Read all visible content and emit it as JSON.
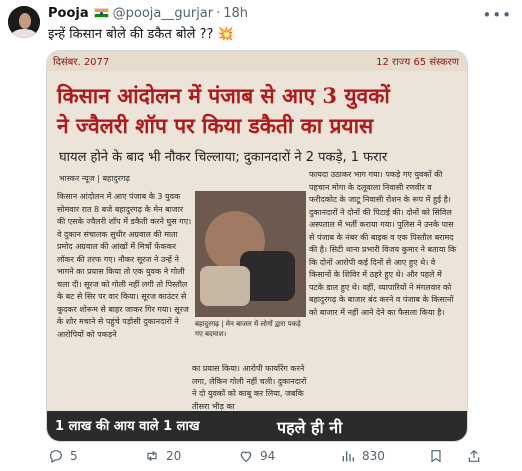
{
  "tweet": {
    "author_name": "Pooja",
    "handle": "@pooja__gurjar",
    "separator": "·",
    "time": "18h",
    "text": "इन्हें किसान बोले की डकैत बोले ?? 💥",
    "more_icon": "more-dots-icon"
  },
  "newspaper": {
    "top_left": "दिसंबर. 2077",
    "top_right": "12 राज्य 65 संस्करण",
    "headline_lines": [
      "किसान आंदोलन में पंजाब से आए 3 युवकों",
      "ने ज्वैलरी शॉप पर किया डकैती का प्रयास"
    ],
    "subheadline": "घायल होने के बाद भी नौकर चिल्लाया; दुकानदारों ने 2 पकड़े, 1 फरार",
    "byline": "भास्कर न्यूज | बहादुरगढ़",
    "left_column": "किसान आंदोलन में आए पंजाब के 3 युवक सोमवार रात 8 बजे बहादुरगढ़ के मेन बाजार की एसके ज्वैलरी शॉप में डकैती करने घुस गए। वे दुकान संचालक सुधीर अग्रवाल की माता प्रमोद अग्रवाल की आंखों में मिर्चो फेंककर लॉकर की तरफ गए। नौकर सूरज ने उन्हें ने भागने का प्रयास किया तो एक युवक ने गोली चला दी। सूरज को गोली नहीं लगी तो पिस्तौल के बट से सिर पर वार किया। सूरज काउंटर से कूदकर शोरूम से बाहर जाकर गिर गया। सूरज के शोर मचाने से पहुंचे पड़ोसी दुकानदारों ने आरोपियों को पकड़ने",
    "photo_caption": "बहादुरगढ़ | मेन बाजार में लोगों द्वारा पकड़े गए बदमाश।",
    "mid_column": "का प्रयास किया। आरोपी फायरिंग करने लगा, लेकिन गोली नहीं चली। दुकानदारों ने दो युवकों को काबू कर लिया, जबकि तीसरा भीड़ का",
    "right_column": "फायदा उठाकर भाग गया। पकड़े गए युवकों की पहचान मोगा के दलूवाला निवासी रणवीर व फरीदकोट के जाटू निवासी रोशन के रूप में हुई है। दुकानदारों ने दोनों की पिटाई की। दोनों को सिविल अस्पताल में भर्ती कराया गया। पुलिस ने उनके पास से पंजाब के नंबर की बाइक व एक पिस्तौल बरामद की है। सिटी थाना प्रभारी विजय कुमार ने बताया कि कि दोनों आरोपी कई दिनों से आए हुए थे। वे किसानों के शिविर में ठहरे हुए थे। और पहले में पटके डाल हुए थे। वहीं, व्यापारियों ने मंगलवार को बहादुरगढ़ के बाजार बंद करने व पंजाब के किसानों को बाजार में नहीं आने देने का फैसला किया है।",
    "bottom_left": "1 लाख की आय वाले 1 लाख",
    "bottom_right": "पहले ही नी"
  },
  "actions": {
    "replies": "5",
    "retweets": "20",
    "likes": "94",
    "views": "830"
  },
  "colors": {
    "headline": "#b0181c",
    "muted": "#536471",
    "text": "#0f1419"
  }
}
